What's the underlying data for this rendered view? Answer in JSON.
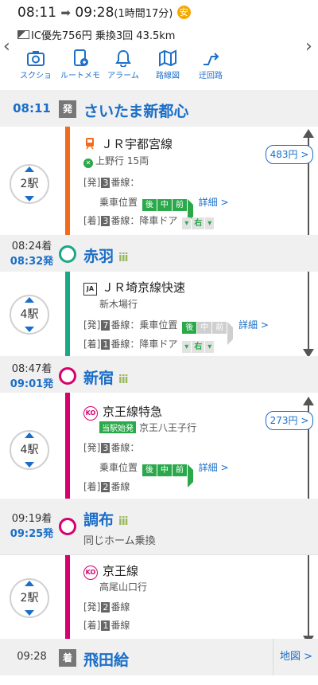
{
  "header": {
    "depart_time": "08:11",
    "arrive_time": "09:28",
    "duration": "(1時間17分)",
    "safety_badge": "安",
    "fare_info": "IC優先756円",
    "transfers": "乗換3回",
    "distance": "43.5km"
  },
  "toolbar": [
    {
      "label": "スクショ",
      "icon": "camera-icon"
    },
    {
      "label": "ルートメモ",
      "icon": "memo-icon"
    },
    {
      "label": "アラーム",
      "icon": "bell-icon"
    },
    {
      "label": "路線図",
      "icon": "map-icon"
    },
    {
      "label": "迂回路",
      "icon": "detour-icon"
    }
  ],
  "colors": {
    "utsunomiya": "#f26a1b",
    "saikyo": "#1aa886",
    "keio": "#d6006e",
    "accent": "#1a6ec8"
  },
  "stations": {
    "s1": {
      "name": "さいたま新都心",
      "dep": "08:11",
      "mark": "発"
    },
    "s2": {
      "name": "赤羽",
      "arr": "08:24着",
      "dep": "08:32発"
    },
    "s3": {
      "name": "新宿",
      "arr": "08:47着",
      "dep": "09:01発"
    },
    "s4": {
      "name": "調布",
      "arr": "09:19着",
      "dep": "09:25発",
      "note": "同じホーム乗換"
    },
    "s5": {
      "name": "飛田給",
      "arr": "09:28",
      "mark": "着"
    }
  },
  "crowd": "iii",
  "legs": {
    "l1": {
      "line": "ＪＲ宇都宮線",
      "dest": "上野行 15両",
      "stops": "2駅",
      "fare": "483円 >",
      "dep_prefix": "[発]",
      "dep_track": "3",
      "dep_suffix": "番線：",
      "pos_label": "乗車位置",
      "car_rear": "後",
      "car_mid": "中",
      "car_front": "前",
      "detail": "詳細 >",
      "arr_prefix": "[着]",
      "arr_track": "3",
      "arr_suffix": "番線：降車ドア",
      "door_right": "右"
    },
    "l2": {
      "line": "ＪＲ埼京線快速",
      "dest": "新木場行",
      "stops": "4駅",
      "dep_prefix": "[発]",
      "dep_track": "7",
      "dep_suffix": "番線：乗車位置",
      "car_rear": "後",
      "car_mid": "中",
      "car_front": "前",
      "detail": "詳細 >",
      "arr_prefix": "[着]",
      "arr_track": "1",
      "arr_suffix": "番線：降車ドア",
      "door_right": "右"
    },
    "l3": {
      "line": "京王線特急",
      "tag": "当駅始発",
      "dest": "京王八王子行",
      "stops": "4駅",
      "fare": "273円 >",
      "dep_prefix": "[発]",
      "dep_track": "3",
      "dep_suffix": "番線：",
      "pos_label": "乗車位置",
      "car_rear": "後",
      "car_mid": "中",
      "car_front": "前",
      "detail": "詳細 >",
      "arr_prefix": "[着]",
      "arr_track": "2",
      "arr_suffix": "番線"
    },
    "l4": {
      "line": "京王線",
      "dest": "高尾山口行",
      "stops": "2駅",
      "dep_prefix": "[発]",
      "dep_track": "2",
      "dep_suffix": "番線",
      "arr_prefix": "[着]",
      "arr_track": "1",
      "arr_suffix": "番線"
    }
  },
  "map_button": "地図 >",
  "logo_ja": "JA",
  "logo_ko": "KO"
}
